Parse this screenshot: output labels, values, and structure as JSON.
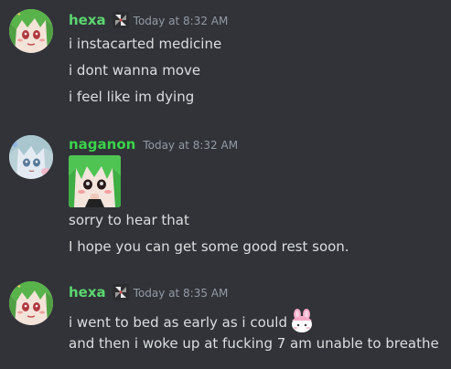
{
  "messages": [
    {
      "author": "hexa",
      "author_color": "#5cd670",
      "badge_icon": "pinwheel-icon",
      "timestamp": "Today at 8:32 AM",
      "lines": [
        "i instacarted medicine",
        "i dont wanna move",
        "i feel like im dying"
      ]
    },
    {
      "author": "naganon",
      "author_color": "#3ad24a",
      "timestamp": "Today at 8:32 AM",
      "sticker": "anime-girl-sticker",
      "lines": [
        "sorry to hear that",
        "I hope you can get some good rest soon."
      ]
    },
    {
      "author": "hexa",
      "author_color": "#5cd670",
      "badge_icon": "pinwheel-icon",
      "timestamp": "Today at 8:35 AM",
      "lines": [
        "i went to bed as early as i could",
        "and then i woke up at fucking 7 am unable to breathe"
      ],
      "emoji": "pink-bunny-emoji"
    }
  ]
}
